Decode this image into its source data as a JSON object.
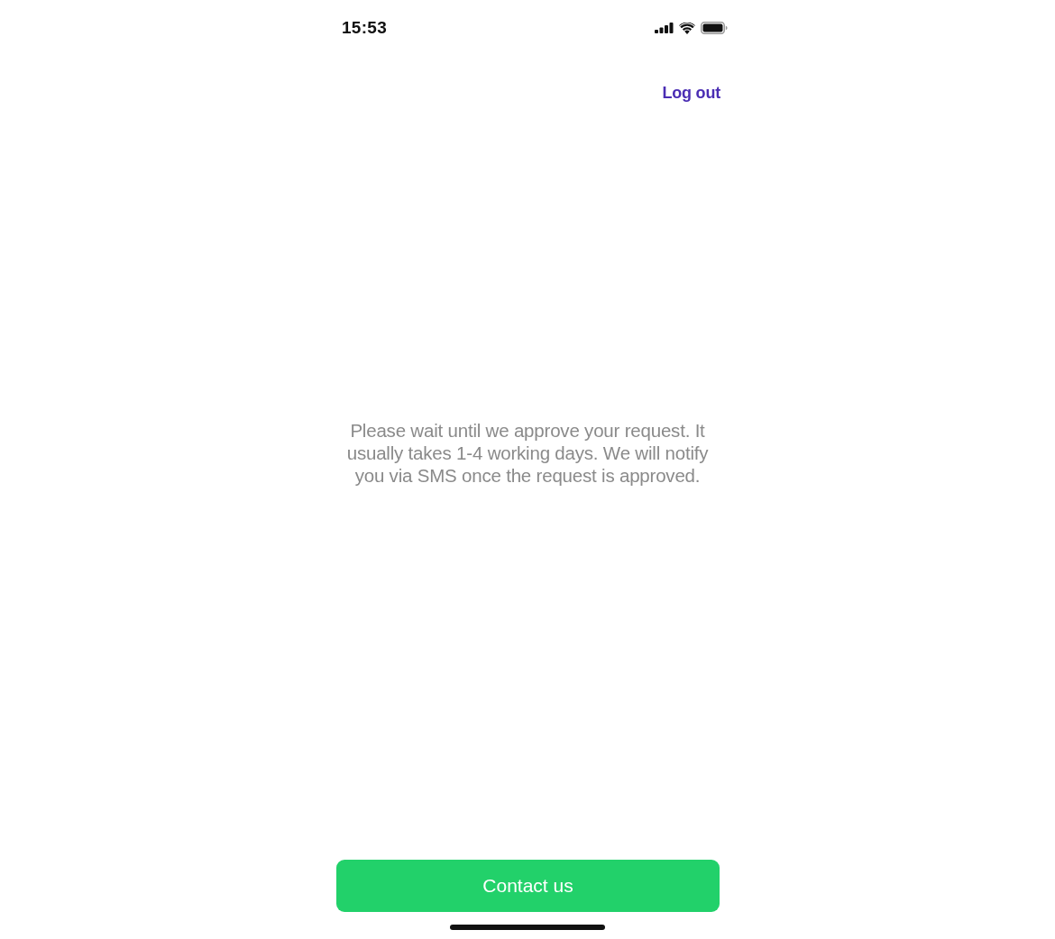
{
  "status_bar": {
    "time": "15:53"
  },
  "header": {
    "log_out": "Log out"
  },
  "message": "Please wait until we approve your request. It usually takes 1-4 working days. We will notify you via SMS once the request is approved.",
  "contact_button": "Contact us"
}
